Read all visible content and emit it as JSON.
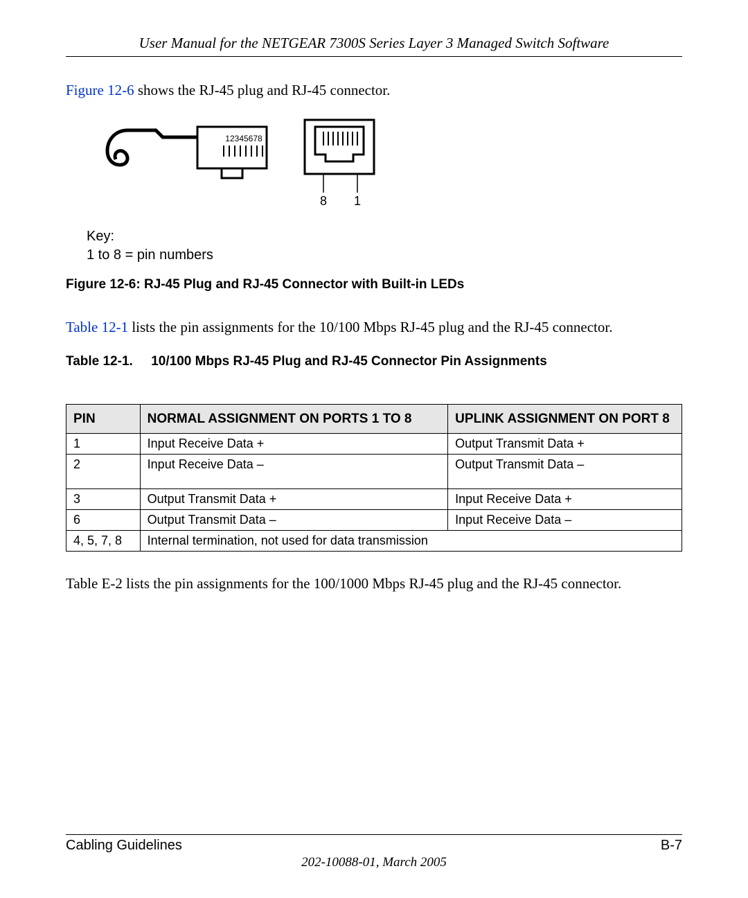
{
  "header": {
    "title": "User Manual for the NETGEAR 7300S Series Layer 3 Managed Switch Software"
  },
  "para1": {
    "link": "Figure 12-6",
    "rest": " shows the RJ-45 plug and RJ-45 connector."
  },
  "figure": {
    "pin_label_plug": "12345678",
    "jack_pin_left": "8",
    "jack_pin_right": "1",
    "key_line1": "Key:",
    "key_line2": " 1 to 8 = pin numbers",
    "caption": "Figure 12-6:  RJ-45 Plug and RJ-45 Connector with Built-in LEDs"
  },
  "para2": {
    "link": "Table 12-1",
    "rest": " lists the pin assignments for the 10/100 Mbps RJ-45 plug and the RJ-45 connector."
  },
  "table_caption": {
    "number": "Table 12-1.",
    "title": "10/100 Mbps RJ-45 Plug and RJ-45 Connector Pin Assignments"
  },
  "table": {
    "headers": {
      "pin": "PIN",
      "normal": "NORMAL ASSIGNMENT ON PORTS 1 TO 8",
      "uplink": "UPLINK ASSIGNMENT ON PORT 8"
    },
    "rows": [
      {
        "pin": "1",
        "normal": "Input Receive Data +",
        "uplink": "Output Transmit Data +"
      },
      {
        "pin": "2",
        "normal": "Input Receive Data –",
        "uplink": "Output Transmit Data –"
      },
      {
        "pin": "3",
        "normal": "Output Transmit Data +",
        "uplink": "Input Receive Data +"
      },
      {
        "pin": "6",
        "normal": "Output Transmit Data –",
        "uplink": "Input Receive Data –"
      }
    ],
    "last_row": {
      "pin": "4, 5, 7, 8",
      "text": "Internal termination, not used for data transmission"
    }
  },
  "para3": "Table E-2 lists the pin assignments for the 100/1000 Mbps RJ-45 plug and the RJ-45 connector.",
  "footer": {
    "left": "Cabling Guidelines",
    "right": "B-7",
    "doc": "202-10088-01, March 2005"
  }
}
